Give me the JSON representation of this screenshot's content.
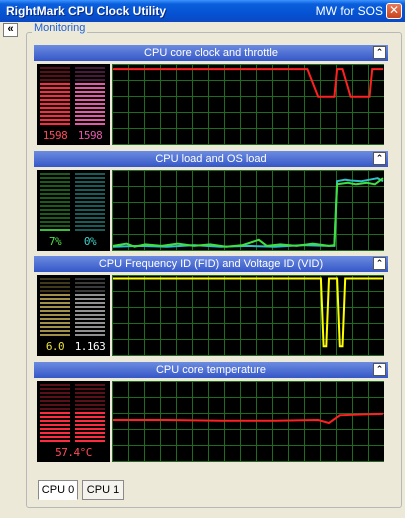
{
  "window": {
    "title": "RightMark CPU Clock Utility",
    "right_label": "MW for SOS",
    "close_glyph": "✕"
  },
  "collapse_glyph": "«",
  "group": {
    "label": "Monitoring"
  },
  "toggle_glyph": "⌃",
  "colors": {
    "graph_grid": "#1f6b1f",
    "graph_bg": "#000000"
  },
  "panels": [
    {
      "id": "clock",
      "title": "CPU core clock and throttle",
      "meters": [
        {
          "value": "1598",
          "fill_fraction": 0.72,
          "on": "#ff2a3d",
          "off": "#5a1018",
          "text_color": "#ff4a5a"
        },
        {
          "value": "1598",
          "fill_fraction": 0.72,
          "on": "#e45aa8",
          "off": "#4a1a3a",
          "text_color": "#e45aa8"
        }
      ],
      "series": [
        {
          "color": "#ff2020",
          "points": [
            [
              0,
              96
            ],
            [
              72,
              96
            ],
            [
              76,
              60
            ],
            [
              82,
              60
            ],
            [
              83,
              96
            ],
            [
              85,
              96
            ],
            [
              88,
              60
            ],
            [
              95,
              60
            ],
            [
              96,
              96
            ],
            [
              100,
              96
            ]
          ]
        }
      ]
    },
    {
      "id": "load",
      "title": "CPU load and OS load",
      "meters": [
        {
          "value": "7%",
          "fill_fraction": 0.07,
          "on": "#38c038",
          "off": "#1e5a1e",
          "text_color": "#4ce04c"
        },
        {
          "value": "0%",
          "fill_fraction": 0.0,
          "on": "#30b8b0",
          "off": "#1a5a58",
          "text_color": "#40d0c8"
        }
      ],
      "series": [
        {
          "color": "#30c0c8",
          "points": [
            [
              0,
              3
            ],
            [
              10,
              4
            ],
            [
              20,
              3
            ],
            [
              30,
              5
            ],
            [
              40,
              3
            ],
            [
              50,
              4
            ],
            [
              60,
              3
            ],
            [
              70,
              5
            ],
            [
              80,
              4
            ],
            [
              82,
              4
            ],
            [
              83,
              88
            ],
            [
              86,
              90
            ],
            [
              88,
              89
            ],
            [
              92,
              88
            ],
            [
              95,
              90
            ],
            [
              98,
              92
            ],
            [
              100,
              88
            ]
          ]
        },
        {
          "color": "#40e040",
          "points": [
            [
              0,
              4
            ],
            [
              5,
              7
            ],
            [
              8,
              3
            ],
            [
              12,
              6
            ],
            [
              18,
              4
            ],
            [
              24,
              7
            ],
            [
              30,
              4
            ],
            [
              36,
              6
            ],
            [
              42,
              3
            ],
            [
              48,
              5
            ],
            [
              54,
              12
            ],
            [
              57,
              4
            ],
            [
              62,
              6
            ],
            [
              68,
              4
            ],
            [
              74,
              7
            ],
            [
              80,
              4
            ],
            [
              82,
              5
            ],
            [
              83,
              84
            ],
            [
              87,
              86
            ],
            [
              90,
              84
            ],
            [
              94,
              86
            ],
            [
              97,
              84
            ],
            [
              100,
              92
            ]
          ]
        }
      ]
    },
    {
      "id": "fid",
      "title": "CPU Frequency ID (FID) and Voltage ID (VID)",
      "meters": [
        {
          "value": "6.0",
          "fill_fraction": 0.75,
          "on": "#a09048",
          "off": "#40381a",
          "text_color": "#e8e040"
        },
        {
          "value": "1.163",
          "fill_fraction": 0.75,
          "on": "#909090",
          "off": "#3a3a3a",
          "text_color": "#ffffff"
        }
      ],
      "series": [
        {
          "color": "#ffff00",
          "points": [
            [
              0,
              98
            ],
            [
              77,
              98
            ],
            [
              78,
              10
            ],
            [
              79,
              10
            ],
            [
              80,
              98
            ],
            [
              83,
              98
            ],
            [
              84,
              10
            ],
            [
              85,
              10
            ],
            [
              86,
              98
            ],
            [
              100,
              98
            ]
          ]
        }
      ]
    },
    {
      "id": "temp",
      "title": "CPU core temperature",
      "meters": [
        {
          "value": "57.4°C",
          "fill_fraction": 0.55,
          "on": "#ff2a3d",
          "off": "#5a1018",
          "text_color": "#ff4a5a"
        }
      ],
      "series": [
        {
          "color": "#ff2020",
          "points": [
            [
              0,
              52
            ],
            [
              20,
              52
            ],
            [
              40,
              51
            ],
            [
              60,
              51
            ],
            [
              76,
              52
            ],
            [
              80,
              48
            ],
            [
              84,
              58
            ],
            [
              90,
              59
            ],
            [
              100,
              60
            ]
          ]
        }
      ]
    }
  ],
  "tabs": [
    {
      "label": "CPU 0",
      "active": true
    },
    {
      "label": "CPU 1",
      "active": false
    }
  ]
}
